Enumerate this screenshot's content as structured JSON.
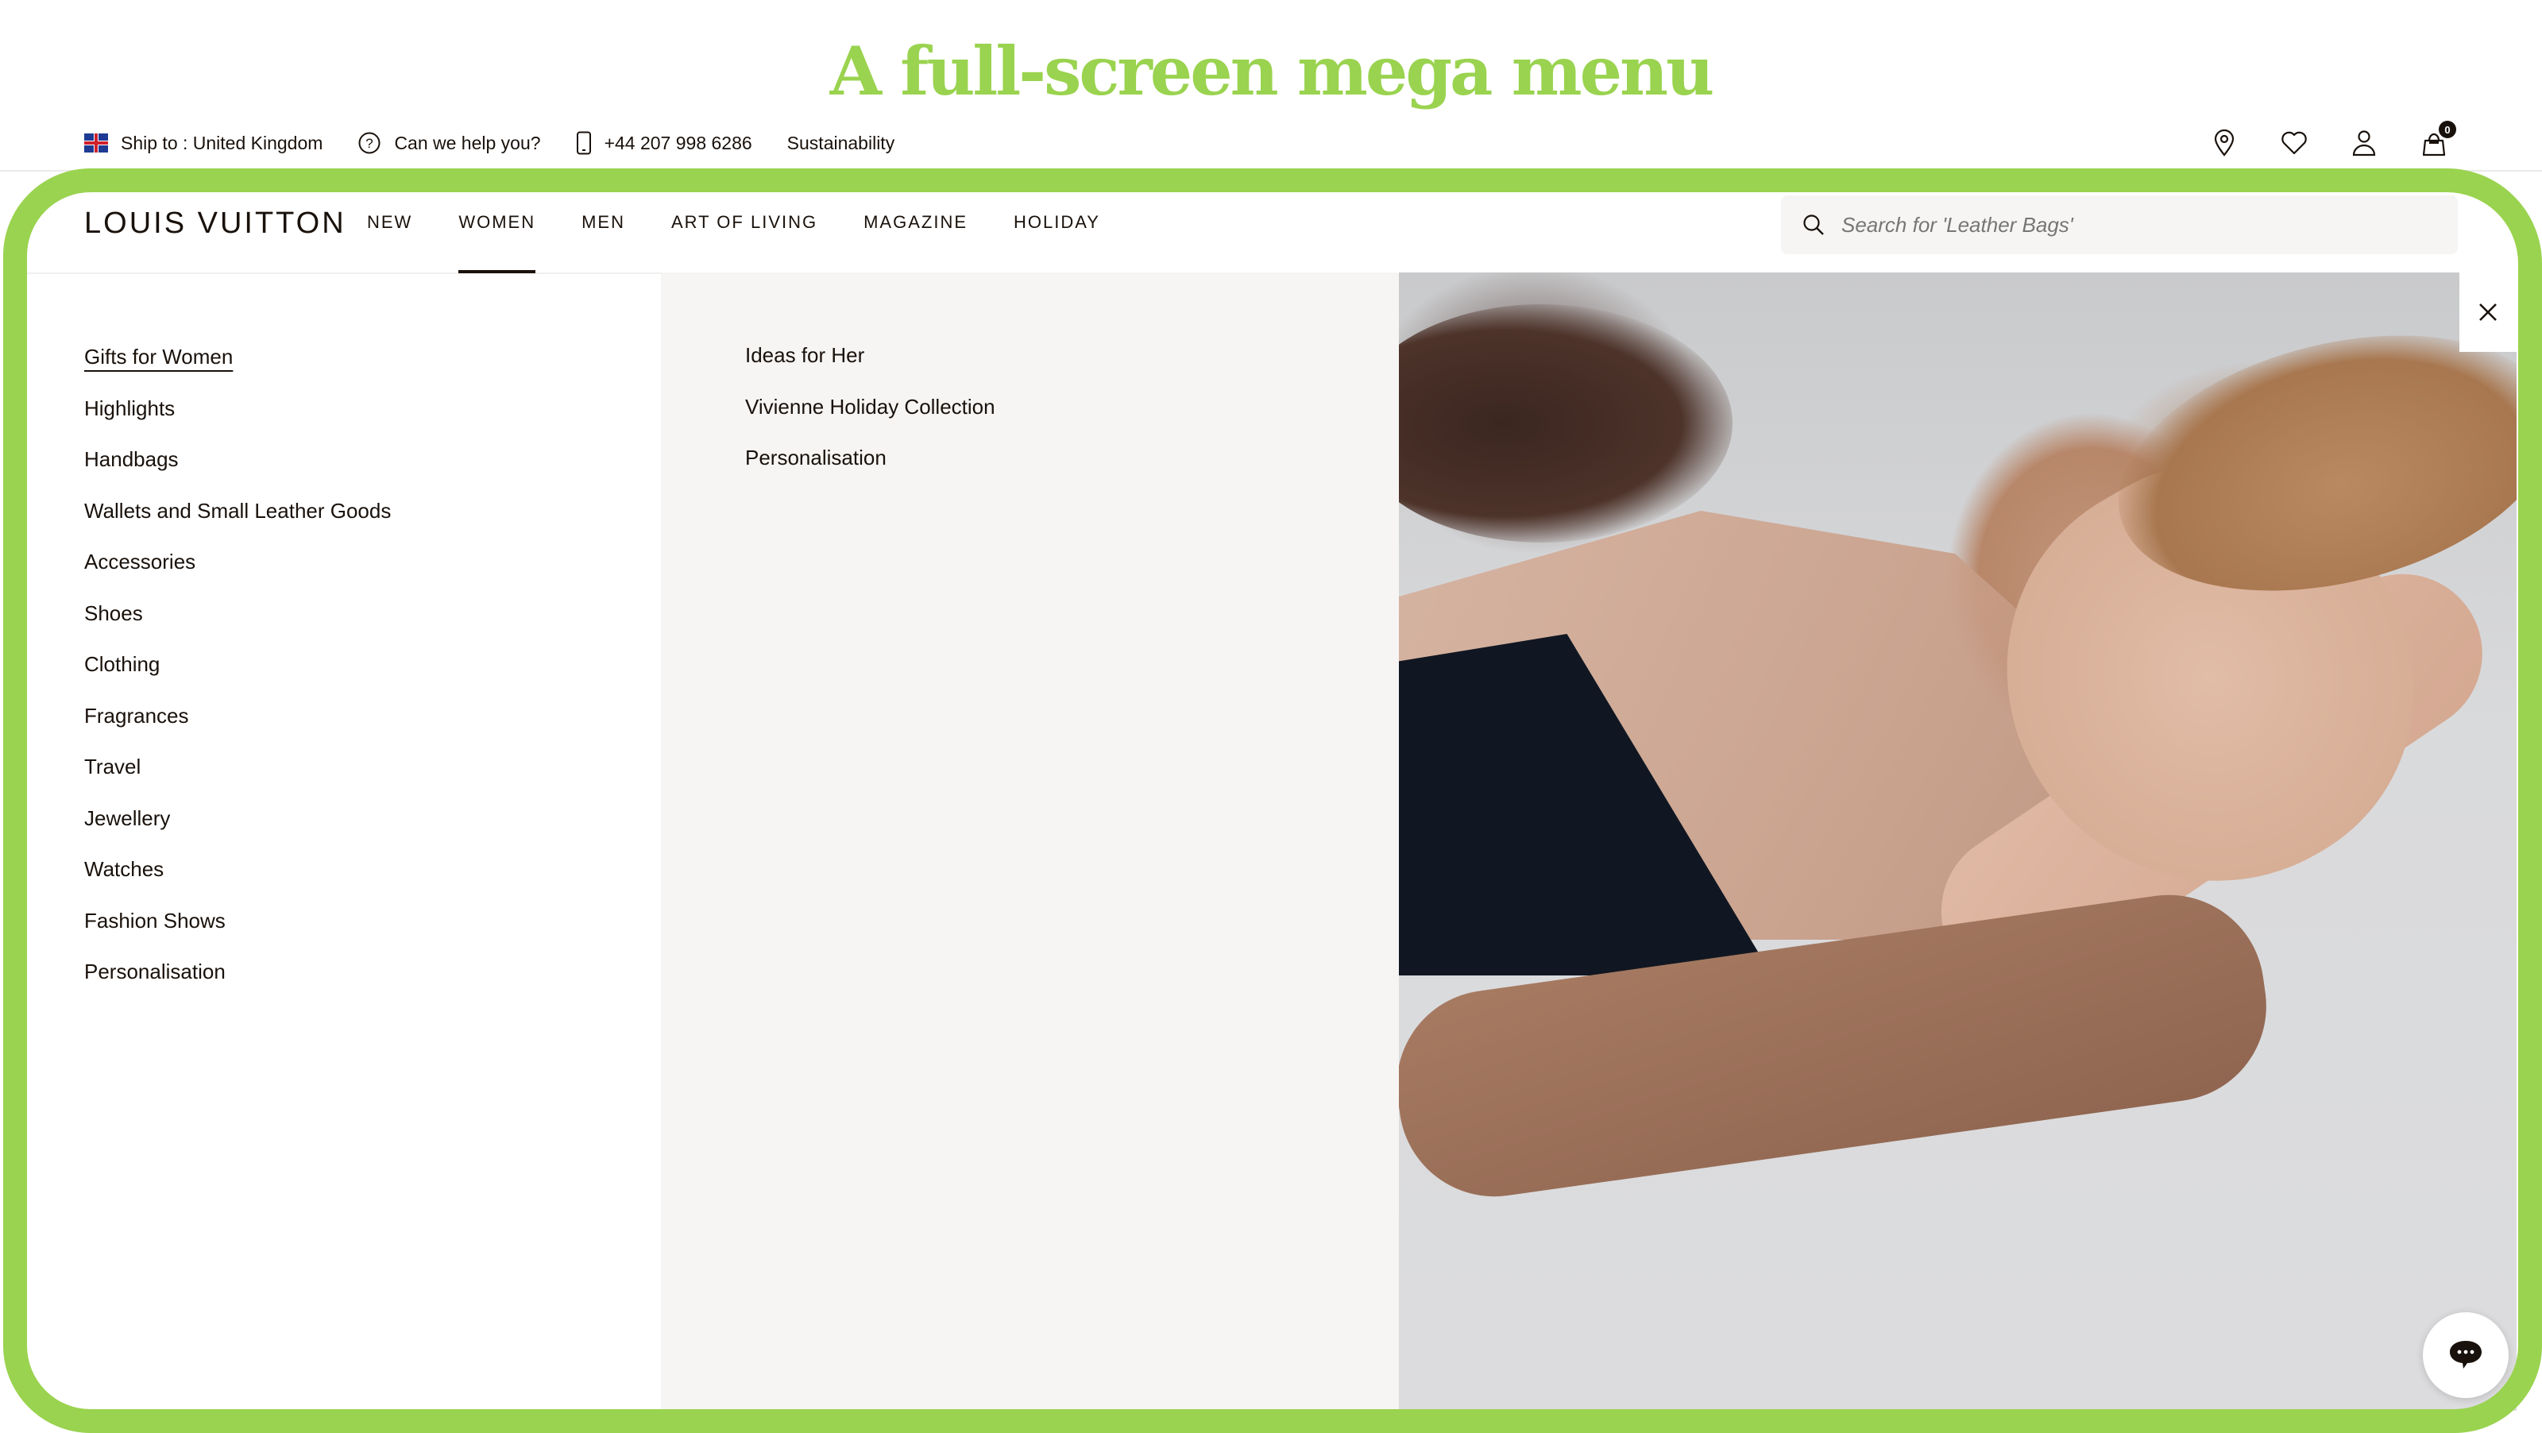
{
  "theme": {
    "accent": "#9ad34f",
    "text": "#19110b",
    "panel_grey": "#f6f5f3"
  },
  "page_title": "A full-screen mega menu",
  "topbar": {
    "ship_to": "Ship to : United Kingdom",
    "help": "Can we help you?",
    "phone": "+44 207 998 6286",
    "sustainability": "Sustainability",
    "icons": [
      "store-locator-icon",
      "wishlist-heart-icon",
      "account-user-icon",
      "shopping-bag-icon"
    ],
    "cart_count": "0"
  },
  "header": {
    "logo": "LOUIS VUITTON",
    "nav": [
      {
        "label": "NEW",
        "active": false
      },
      {
        "label": "WOMEN",
        "active": true
      },
      {
        "label": "MEN",
        "active": false
      },
      {
        "label": "ART OF LIVING",
        "active": false
      },
      {
        "label": "MAGAZINE",
        "active": false
      },
      {
        "label": "HOLIDAY",
        "active": false
      }
    ],
    "search_placeholder": "Search for 'Leather Bags'"
  },
  "mega_menu": {
    "primary": [
      {
        "label": "Gifts for Women",
        "featured": true
      },
      {
        "label": "Highlights"
      },
      {
        "label": "Handbags"
      },
      {
        "label": "Wallets and Small Leather Goods"
      },
      {
        "label": "Accessories"
      },
      {
        "label": "Shoes"
      },
      {
        "label": "Clothing"
      },
      {
        "label": "Fragrances"
      },
      {
        "label": "Travel"
      },
      {
        "label": "Jewellery"
      },
      {
        "label": "Watches"
      },
      {
        "label": "Fashion Shows"
      },
      {
        "label": "Personalisation"
      }
    ],
    "secondary": [
      {
        "label": "Ideas for Her"
      },
      {
        "label": "Vivienne Holiday Collection"
      },
      {
        "label": "Personalisation"
      }
    ],
    "promo_image": "couple-lying-on-white-bedsheets-photo"
  }
}
